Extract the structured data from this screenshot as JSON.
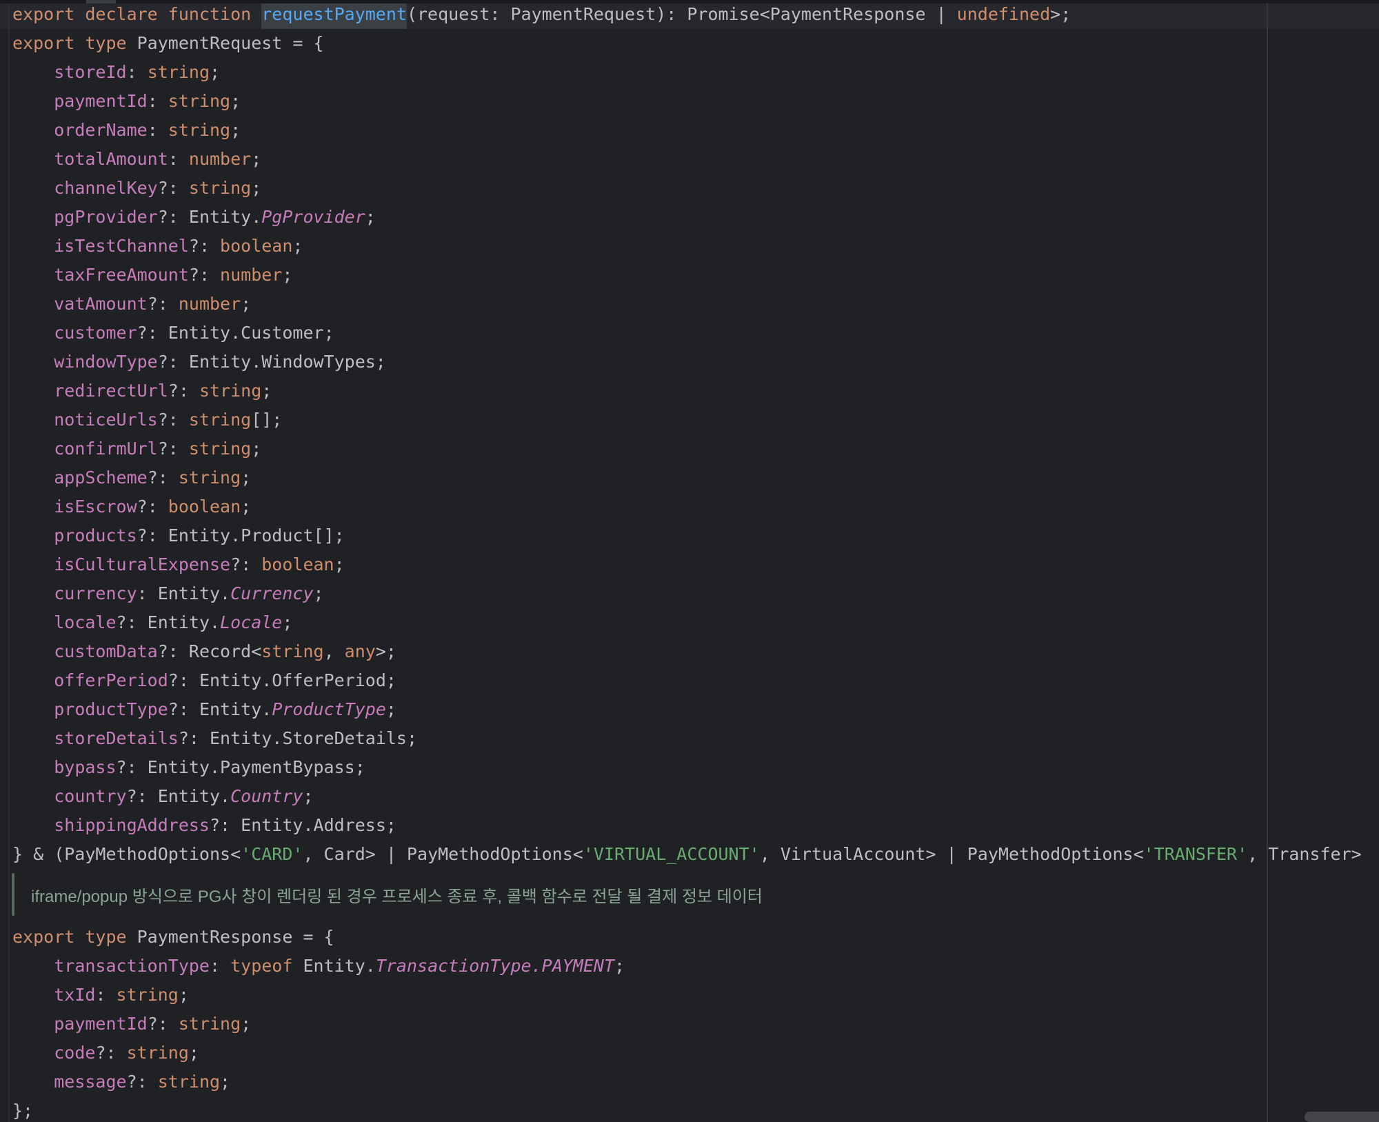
{
  "app": {
    "kind": "ide-code-editor",
    "language": "TypeScript declaration"
  },
  "colors": {
    "editor_background": "#1F2124",
    "current_line_background": "#26282E",
    "identifier_highlight_background": "#3B4045",
    "keyword": "#CF8E6D",
    "property": "#C77DBB",
    "italic_type": "#C77DBB",
    "function_name": "#56A8F5",
    "string_literal": "#6AAB73",
    "default_text": "#BCBEC4",
    "doc_comment_text": "#8BA395",
    "doc_comment_bar": "#56695C",
    "right_margin_guide": "#35383D",
    "scrollbar_thumb": "#43454A"
  },
  "code": {
    "lines": [
      {
        "indent": 0,
        "current": true,
        "tokens": [
          [
            "kw",
            "export declare function "
          ],
          [
            "fnhl",
            "requestPayment"
          ],
          [
            "plain",
            "(request: PaymentRequest): Promise<PaymentResponse | "
          ],
          [
            "kw",
            "undefined"
          ],
          [
            "plain",
            ">;"
          ]
        ]
      },
      {
        "indent": 0,
        "tokens": [
          [
            "kw",
            "export type "
          ],
          [
            "plain",
            "PaymentRequest = {"
          ]
        ]
      },
      {
        "indent": 1,
        "tokens": [
          [
            "prop",
            "storeId"
          ],
          [
            "plain",
            ": "
          ],
          [
            "kw",
            "string"
          ],
          [
            "plain",
            ";"
          ]
        ]
      },
      {
        "indent": 1,
        "tokens": [
          [
            "prop",
            "paymentId"
          ],
          [
            "plain",
            ": "
          ],
          [
            "kw",
            "string"
          ],
          [
            "plain",
            ";"
          ]
        ]
      },
      {
        "indent": 1,
        "tokens": [
          [
            "prop",
            "orderName"
          ],
          [
            "plain",
            ": "
          ],
          [
            "kw",
            "string"
          ],
          [
            "plain",
            ";"
          ]
        ]
      },
      {
        "indent": 1,
        "tokens": [
          [
            "prop",
            "totalAmount"
          ],
          [
            "plain",
            ": "
          ],
          [
            "kw",
            "number"
          ],
          [
            "plain",
            ";"
          ]
        ]
      },
      {
        "indent": 1,
        "tokens": [
          [
            "prop",
            "channelKey"
          ],
          [
            "plain",
            "?: "
          ],
          [
            "kw",
            "string"
          ],
          [
            "plain",
            ";"
          ]
        ]
      },
      {
        "indent": 1,
        "tokens": [
          [
            "prop",
            "pgProvider"
          ],
          [
            "plain",
            "?: Entity."
          ],
          [
            "typei",
            "PgProvider"
          ],
          [
            "plain",
            ";"
          ]
        ]
      },
      {
        "indent": 1,
        "tokens": [
          [
            "prop",
            "isTestChannel"
          ],
          [
            "plain",
            "?: "
          ],
          [
            "kw",
            "boolean"
          ],
          [
            "plain",
            ";"
          ]
        ]
      },
      {
        "indent": 1,
        "tokens": [
          [
            "prop",
            "taxFreeAmount"
          ],
          [
            "plain",
            "?: "
          ],
          [
            "kw",
            "number"
          ],
          [
            "plain",
            ";"
          ]
        ]
      },
      {
        "indent": 1,
        "tokens": [
          [
            "prop",
            "vatAmount"
          ],
          [
            "plain",
            "?: "
          ],
          [
            "kw",
            "number"
          ],
          [
            "plain",
            ";"
          ]
        ]
      },
      {
        "indent": 1,
        "tokens": [
          [
            "prop",
            "customer"
          ],
          [
            "plain",
            "?: Entity.Customer;"
          ]
        ]
      },
      {
        "indent": 1,
        "tokens": [
          [
            "prop",
            "windowType"
          ],
          [
            "plain",
            "?: Entity.WindowTypes;"
          ]
        ]
      },
      {
        "indent": 1,
        "tokens": [
          [
            "prop",
            "redirectUrl"
          ],
          [
            "plain",
            "?: "
          ],
          [
            "kw",
            "string"
          ],
          [
            "plain",
            ";"
          ]
        ]
      },
      {
        "indent": 1,
        "tokens": [
          [
            "prop",
            "noticeUrls"
          ],
          [
            "plain",
            "?: "
          ],
          [
            "kw",
            "string"
          ],
          [
            "plain",
            "[];"
          ]
        ]
      },
      {
        "indent": 1,
        "tokens": [
          [
            "prop",
            "confirmUrl"
          ],
          [
            "plain",
            "?: "
          ],
          [
            "kw",
            "string"
          ],
          [
            "plain",
            ";"
          ]
        ]
      },
      {
        "indent": 1,
        "tokens": [
          [
            "prop",
            "appScheme"
          ],
          [
            "plain",
            "?: "
          ],
          [
            "kw",
            "string"
          ],
          [
            "plain",
            ";"
          ]
        ]
      },
      {
        "indent": 1,
        "tokens": [
          [
            "prop",
            "isEscrow"
          ],
          [
            "plain",
            "?: "
          ],
          [
            "kw",
            "boolean"
          ],
          [
            "plain",
            ";"
          ]
        ]
      },
      {
        "indent": 1,
        "tokens": [
          [
            "prop",
            "products"
          ],
          [
            "plain",
            "?: Entity.Product[];"
          ]
        ]
      },
      {
        "indent": 1,
        "tokens": [
          [
            "prop",
            "isCulturalExpense"
          ],
          [
            "plain",
            "?: "
          ],
          [
            "kw",
            "boolean"
          ],
          [
            "plain",
            ";"
          ]
        ]
      },
      {
        "indent": 1,
        "tokens": [
          [
            "prop",
            "currency"
          ],
          [
            "plain",
            ": Entity."
          ],
          [
            "typei",
            "Currency"
          ],
          [
            "plain",
            ";"
          ]
        ]
      },
      {
        "indent": 1,
        "tokens": [
          [
            "prop",
            "locale"
          ],
          [
            "plain",
            "?: Entity."
          ],
          [
            "typei",
            "Locale"
          ],
          [
            "plain",
            ";"
          ]
        ]
      },
      {
        "indent": 1,
        "tokens": [
          [
            "prop",
            "customData"
          ],
          [
            "plain",
            "?: Record<"
          ],
          [
            "kw",
            "string"
          ],
          [
            "plain",
            ", "
          ],
          [
            "kw",
            "any"
          ],
          [
            "plain",
            ">;"
          ]
        ]
      },
      {
        "indent": 1,
        "tokens": [
          [
            "prop",
            "offerPeriod"
          ],
          [
            "plain",
            "?: Entity.OfferPeriod;"
          ]
        ]
      },
      {
        "indent": 1,
        "tokens": [
          [
            "prop",
            "productType"
          ],
          [
            "plain",
            "?: Entity."
          ],
          [
            "typei",
            "ProductType"
          ],
          [
            "plain",
            ";"
          ]
        ]
      },
      {
        "indent": 1,
        "tokens": [
          [
            "prop",
            "storeDetails"
          ],
          [
            "plain",
            "?: Entity.StoreDetails;"
          ]
        ]
      },
      {
        "indent": 1,
        "tokens": [
          [
            "prop",
            "bypass"
          ],
          [
            "plain",
            "?: Entity.PaymentBypass;"
          ]
        ]
      },
      {
        "indent": 1,
        "tokens": [
          [
            "prop",
            "country"
          ],
          [
            "plain",
            "?: Entity."
          ],
          [
            "typei",
            "Country"
          ],
          [
            "plain",
            ";"
          ]
        ]
      },
      {
        "indent": 1,
        "tokens": [
          [
            "prop",
            "shippingAddress"
          ],
          [
            "plain",
            "?: Entity.Address;"
          ]
        ]
      },
      {
        "indent": 0,
        "tokens": [
          [
            "plain",
            "} & (PayMethodOptions<"
          ],
          [
            "str",
            "'CARD'"
          ],
          [
            "plain",
            ", Card> | PayMethodOptions<"
          ],
          [
            "str",
            "'VIRTUAL_ACCOUNT'"
          ],
          [
            "plain",
            ", VirtualAccount> | PayMethodOptions<"
          ],
          [
            "str",
            "'TRANSFER'"
          ],
          [
            "plain",
            ", Transfer>"
          ]
        ]
      },
      {
        "doc": true,
        "text": "iframe/popup 방식으로 PG사 창이 렌더링 된 경우 프로세스 종료 후, 콜백 함수로 전달 될 결제 정보 데이터"
      },
      {
        "indent": 0,
        "tokens": [
          [
            "kw",
            "export type "
          ],
          [
            "plain",
            "PaymentResponse = {"
          ]
        ]
      },
      {
        "indent": 1,
        "tokens": [
          [
            "prop",
            "transactionType"
          ],
          [
            "plain",
            ": "
          ],
          [
            "kw",
            "typeof "
          ],
          [
            "plain",
            "Entity."
          ],
          [
            "typei",
            "TransactionType.PAYMENT"
          ],
          [
            "plain",
            ";"
          ]
        ]
      },
      {
        "indent": 1,
        "tokens": [
          [
            "prop",
            "txId"
          ],
          [
            "plain",
            ": "
          ],
          [
            "kw",
            "string"
          ],
          [
            "plain",
            ";"
          ]
        ]
      },
      {
        "indent": 1,
        "tokens": [
          [
            "prop",
            "paymentId"
          ],
          [
            "plain",
            "?: "
          ],
          [
            "kw",
            "string"
          ],
          [
            "plain",
            ";"
          ]
        ]
      },
      {
        "indent": 1,
        "tokens": [
          [
            "prop",
            "code"
          ],
          [
            "plain",
            "?: "
          ],
          [
            "kw",
            "string"
          ],
          [
            "plain",
            ";"
          ]
        ]
      },
      {
        "indent": 1,
        "tokens": [
          [
            "prop",
            "message"
          ],
          [
            "plain",
            "?: "
          ],
          [
            "kw",
            "string"
          ],
          [
            "plain",
            ";"
          ]
        ]
      },
      {
        "indent": 0,
        "tokens": [
          [
            "plain",
            "};"
          ]
        ]
      }
    ]
  },
  "decorations": {
    "highlighted_identifier": "requestPayment",
    "right_margin_guide_x": 1837,
    "has_horizontal_scrollbar_thumb": true
  }
}
